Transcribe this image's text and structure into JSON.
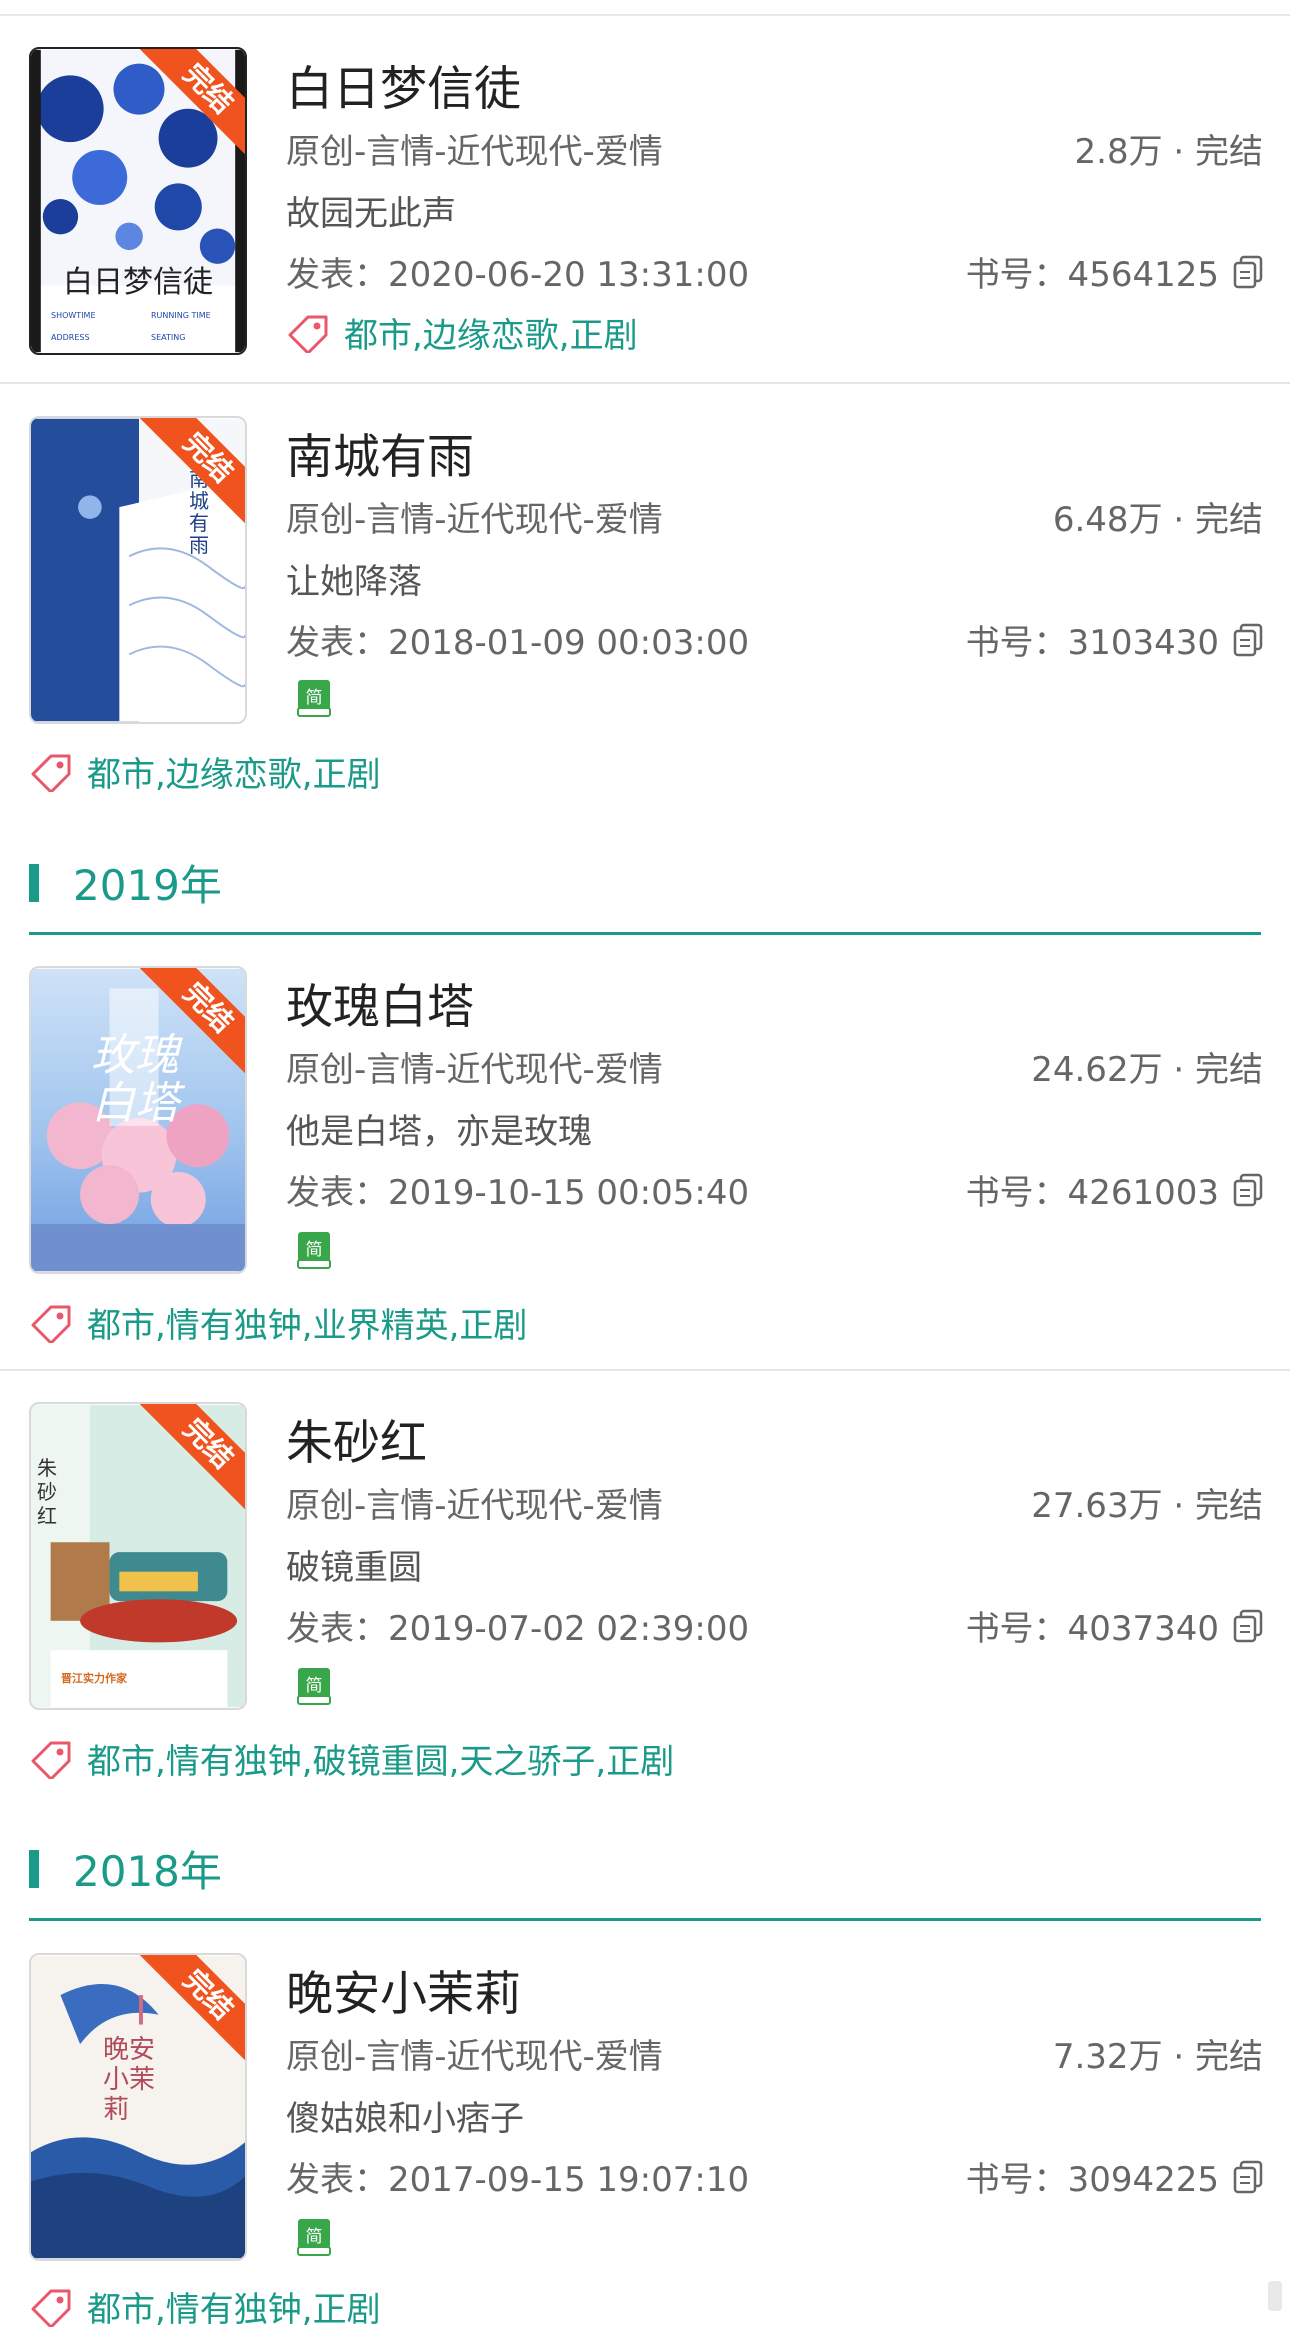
{
  "books": [
    {
      "title": "白日梦信徒",
      "category": "原创-言情-近代现代-爱情",
      "stats": "2.8万 · 完结",
      "desc": "故园无此声",
      "date": "发表：2020-06-20 13:31:00",
      "book_id": "书号：4564125",
      "ribbon": "完结",
      "tags": "都市,边缘恋歌,正剧",
      "cover_text": "白日梦信徒",
      "cover_small": [
        "SHOWTIME",
        "RUNNING TIME",
        "ADDRESS",
        "SEATING"
      ]
    },
    {
      "title": "南城有雨",
      "category": "原创-言情-近代现代-爱情",
      "stats": "6.48万 · 完结",
      "desc": "让她降落",
      "date": "发表：2018-01-09 00:03:00",
      "book_id": "书号：3103430",
      "ribbon": "完结",
      "badge": "简",
      "tags": "都市,边缘恋歌,正剧",
      "cover_text": "南城有雨"
    },
    {
      "title": "玫瑰白塔",
      "category": "原创-言情-近代现代-爱情",
      "stats": "24.62万 · 完结",
      "desc": "他是白塔，亦是玫瑰",
      "date": "发表：2019-10-15 00:05:40",
      "book_id": "书号：4261003",
      "ribbon": "完结",
      "badge": "简",
      "tags": "都市,情有独钟,业界精英,正剧",
      "cover_text": "玫瑰白塔"
    },
    {
      "title": "朱砂红",
      "category": "原创-言情-近代现代-爱情",
      "stats": "27.63万 · 完结",
      "desc": "破镜重圆",
      "date": "发表：2019-07-02 02:39:00",
      "book_id": "书号：4037340",
      "ribbon": "完结",
      "badge": "简",
      "tags": "都市,情有独钟,破镜重圆,天之骄子,正剧",
      "cover_text": "朱砂红",
      "cover_small": "晋江实力作家"
    },
    {
      "title": "晚安小茉莉",
      "category": "原创-言情-近代现代-爱情",
      "stats": "7.32万 · 完结",
      "desc": "傻姑娘和小痞子",
      "date": "发表：2017-09-15 19:07:10",
      "book_id": "书号：3094225",
      "ribbon": "完结",
      "badge": "简",
      "tags": "都市,情有独钟,正剧",
      "cover_text": "晚安小茉莉"
    }
  ],
  "years": [
    "2019年",
    "2018年"
  ],
  "colors": {
    "accent": "#1a9a88",
    "ribbon": "#f0531e",
    "tag_icon": "#e8576a",
    "badge": "#3aa64a"
  }
}
